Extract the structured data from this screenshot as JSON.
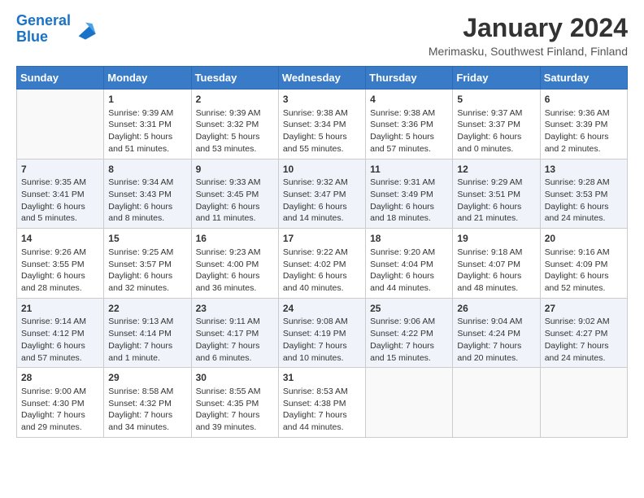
{
  "logo": {
    "line1": "General",
    "line2": "Blue"
  },
  "title": "January 2024",
  "location": "Merimasku, Southwest Finland, Finland",
  "weekdays": [
    "Sunday",
    "Monday",
    "Tuesday",
    "Wednesday",
    "Thursday",
    "Friday",
    "Saturday"
  ],
  "weeks": [
    [
      {
        "day": "",
        "info": ""
      },
      {
        "day": "1",
        "info": "Sunrise: 9:39 AM\nSunset: 3:31 PM\nDaylight: 5 hours\nand 51 minutes."
      },
      {
        "day": "2",
        "info": "Sunrise: 9:39 AM\nSunset: 3:32 PM\nDaylight: 5 hours\nand 53 minutes."
      },
      {
        "day": "3",
        "info": "Sunrise: 9:38 AM\nSunset: 3:34 PM\nDaylight: 5 hours\nand 55 minutes."
      },
      {
        "day": "4",
        "info": "Sunrise: 9:38 AM\nSunset: 3:36 PM\nDaylight: 5 hours\nand 57 minutes."
      },
      {
        "day": "5",
        "info": "Sunrise: 9:37 AM\nSunset: 3:37 PM\nDaylight: 6 hours\nand 0 minutes."
      },
      {
        "day": "6",
        "info": "Sunrise: 9:36 AM\nSunset: 3:39 PM\nDaylight: 6 hours\nand 2 minutes."
      }
    ],
    [
      {
        "day": "7",
        "info": "Sunrise: 9:35 AM\nSunset: 3:41 PM\nDaylight: 6 hours\nand 5 minutes."
      },
      {
        "day": "8",
        "info": "Sunrise: 9:34 AM\nSunset: 3:43 PM\nDaylight: 6 hours\nand 8 minutes."
      },
      {
        "day": "9",
        "info": "Sunrise: 9:33 AM\nSunset: 3:45 PM\nDaylight: 6 hours\nand 11 minutes."
      },
      {
        "day": "10",
        "info": "Sunrise: 9:32 AM\nSunset: 3:47 PM\nDaylight: 6 hours\nand 14 minutes."
      },
      {
        "day": "11",
        "info": "Sunrise: 9:31 AM\nSunset: 3:49 PM\nDaylight: 6 hours\nand 18 minutes."
      },
      {
        "day": "12",
        "info": "Sunrise: 9:29 AM\nSunset: 3:51 PM\nDaylight: 6 hours\nand 21 minutes."
      },
      {
        "day": "13",
        "info": "Sunrise: 9:28 AM\nSunset: 3:53 PM\nDaylight: 6 hours\nand 24 minutes."
      }
    ],
    [
      {
        "day": "14",
        "info": "Sunrise: 9:26 AM\nSunset: 3:55 PM\nDaylight: 6 hours\nand 28 minutes."
      },
      {
        "day": "15",
        "info": "Sunrise: 9:25 AM\nSunset: 3:57 PM\nDaylight: 6 hours\nand 32 minutes."
      },
      {
        "day": "16",
        "info": "Sunrise: 9:23 AM\nSunset: 4:00 PM\nDaylight: 6 hours\nand 36 minutes."
      },
      {
        "day": "17",
        "info": "Sunrise: 9:22 AM\nSunset: 4:02 PM\nDaylight: 6 hours\nand 40 minutes."
      },
      {
        "day": "18",
        "info": "Sunrise: 9:20 AM\nSunset: 4:04 PM\nDaylight: 6 hours\nand 44 minutes."
      },
      {
        "day": "19",
        "info": "Sunrise: 9:18 AM\nSunset: 4:07 PM\nDaylight: 6 hours\nand 48 minutes."
      },
      {
        "day": "20",
        "info": "Sunrise: 9:16 AM\nSunset: 4:09 PM\nDaylight: 6 hours\nand 52 minutes."
      }
    ],
    [
      {
        "day": "21",
        "info": "Sunrise: 9:14 AM\nSunset: 4:12 PM\nDaylight: 6 hours\nand 57 minutes."
      },
      {
        "day": "22",
        "info": "Sunrise: 9:13 AM\nSunset: 4:14 PM\nDaylight: 7 hours\nand 1 minute."
      },
      {
        "day": "23",
        "info": "Sunrise: 9:11 AM\nSunset: 4:17 PM\nDaylight: 7 hours\nand 6 minutes."
      },
      {
        "day": "24",
        "info": "Sunrise: 9:08 AM\nSunset: 4:19 PM\nDaylight: 7 hours\nand 10 minutes."
      },
      {
        "day": "25",
        "info": "Sunrise: 9:06 AM\nSunset: 4:22 PM\nDaylight: 7 hours\nand 15 minutes."
      },
      {
        "day": "26",
        "info": "Sunrise: 9:04 AM\nSunset: 4:24 PM\nDaylight: 7 hours\nand 20 minutes."
      },
      {
        "day": "27",
        "info": "Sunrise: 9:02 AM\nSunset: 4:27 PM\nDaylight: 7 hours\nand 24 minutes."
      }
    ],
    [
      {
        "day": "28",
        "info": "Sunrise: 9:00 AM\nSunset: 4:30 PM\nDaylight: 7 hours\nand 29 minutes."
      },
      {
        "day": "29",
        "info": "Sunrise: 8:58 AM\nSunset: 4:32 PM\nDaylight: 7 hours\nand 34 minutes."
      },
      {
        "day": "30",
        "info": "Sunrise: 8:55 AM\nSunset: 4:35 PM\nDaylight: 7 hours\nand 39 minutes."
      },
      {
        "day": "31",
        "info": "Sunrise: 8:53 AM\nSunset: 4:38 PM\nDaylight: 7 hours\nand 44 minutes."
      },
      {
        "day": "",
        "info": ""
      },
      {
        "day": "",
        "info": ""
      },
      {
        "day": "",
        "info": ""
      }
    ]
  ]
}
